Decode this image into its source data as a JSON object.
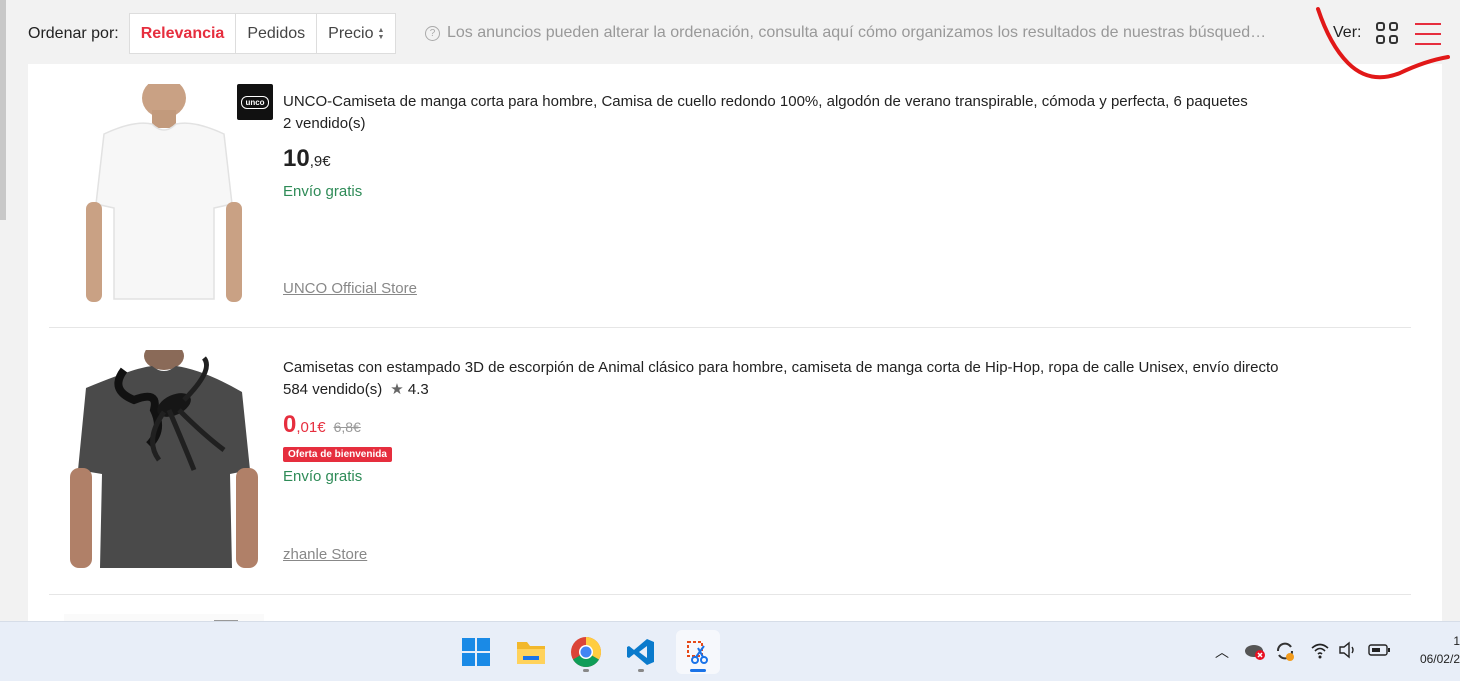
{
  "sort": {
    "label": "Ordenar por:",
    "options": [
      "Relevancia",
      "Pedidos",
      "Precio"
    ],
    "selected": "Relevancia"
  },
  "notice": "Los anuncios pueden alterar la ordenación, consulta aquí cómo organizamos los resultados de nuestras búsqued…",
  "view": {
    "label": "Ver:",
    "modes": [
      "grid",
      "list"
    ],
    "selected": "list"
  },
  "products": [
    {
      "title": "UNCO-Camiseta de manga corta para hombre, Camisa de cuello redondo 100%, algodón de verano transpirable, cómoda y perfecta, 6 paquetes",
      "sold": "2 vendido(s)",
      "price_int": "10",
      "price_dec": ",9€",
      "shipping": "Envío gratis",
      "store": "UNCO Official Store",
      "brand_logo": "unco"
    },
    {
      "title": "Camisetas con estampado 3D de escorpión de Animal clásico para hombre, camiseta de manga corta de Hip-Hop, ropa de calle Unisex, envío directo",
      "sold": "584 vendido(s)",
      "rating": "4.3",
      "price_int": "0",
      "price_dec": ",01€",
      "original_price": "6,8€",
      "badge": "Oferta de bienvenida",
      "shipping": "Envío gratis",
      "store": "zhanle Store"
    }
  ],
  "taskbar": {
    "apps": [
      "windows-start",
      "file-explorer",
      "chrome",
      "vs-code",
      "snipping-tool"
    ],
    "active": "snipping-tool",
    "clock_time": "1",
    "clock_date": "06/02/2"
  },
  "colors": {
    "accent": "#e62e3e",
    "shipping": "#2e8b57"
  }
}
